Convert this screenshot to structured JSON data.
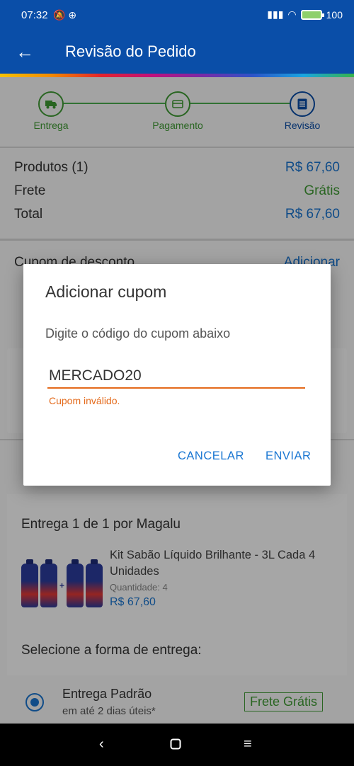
{
  "status": {
    "time": "07:32",
    "battery": "100"
  },
  "appbar": {
    "title": "Revisão do Pedido"
  },
  "steps": [
    {
      "label": "Entrega"
    },
    {
      "label": "Pagamento"
    },
    {
      "label": "Revisão"
    }
  ],
  "summary": {
    "rows": [
      {
        "label": "Produtos (1)",
        "value": "R$ 67,60"
      },
      {
        "label": "Frete",
        "value": "Grátis"
      },
      {
        "label": "Total",
        "value": "R$ 67,60"
      }
    ]
  },
  "coupon": {
    "label": "Cupom de desconto",
    "action": "Adicionar"
  },
  "delivery": {
    "heading": "Entrega 1 de 1 por Magalu",
    "product": {
      "name": "Kit Sabão Líquido Brilhante - 3L Cada 4 Unidades",
      "quantity_label": "Quantidade:",
      "quantity": "4",
      "price": "R$ 67,60"
    },
    "select_label": "Selecione a forma de entrega:",
    "option": {
      "title": "Entrega Padrão",
      "subtitle": "em até 2 dias úteis*",
      "badge": "Frete Grátis"
    }
  },
  "dialog": {
    "title": "Adicionar cupom",
    "message": "Digite o código do cupom abaixo",
    "input_value": "MERCADO20",
    "error": "Cupom inválido.",
    "cancel": "CANCELAR",
    "submit": "ENVIAR"
  },
  "colors": {
    "primary": "#0a4ea8",
    "accent": "#1976d2",
    "success": "#3f9c34",
    "error": "#e46a1b"
  }
}
